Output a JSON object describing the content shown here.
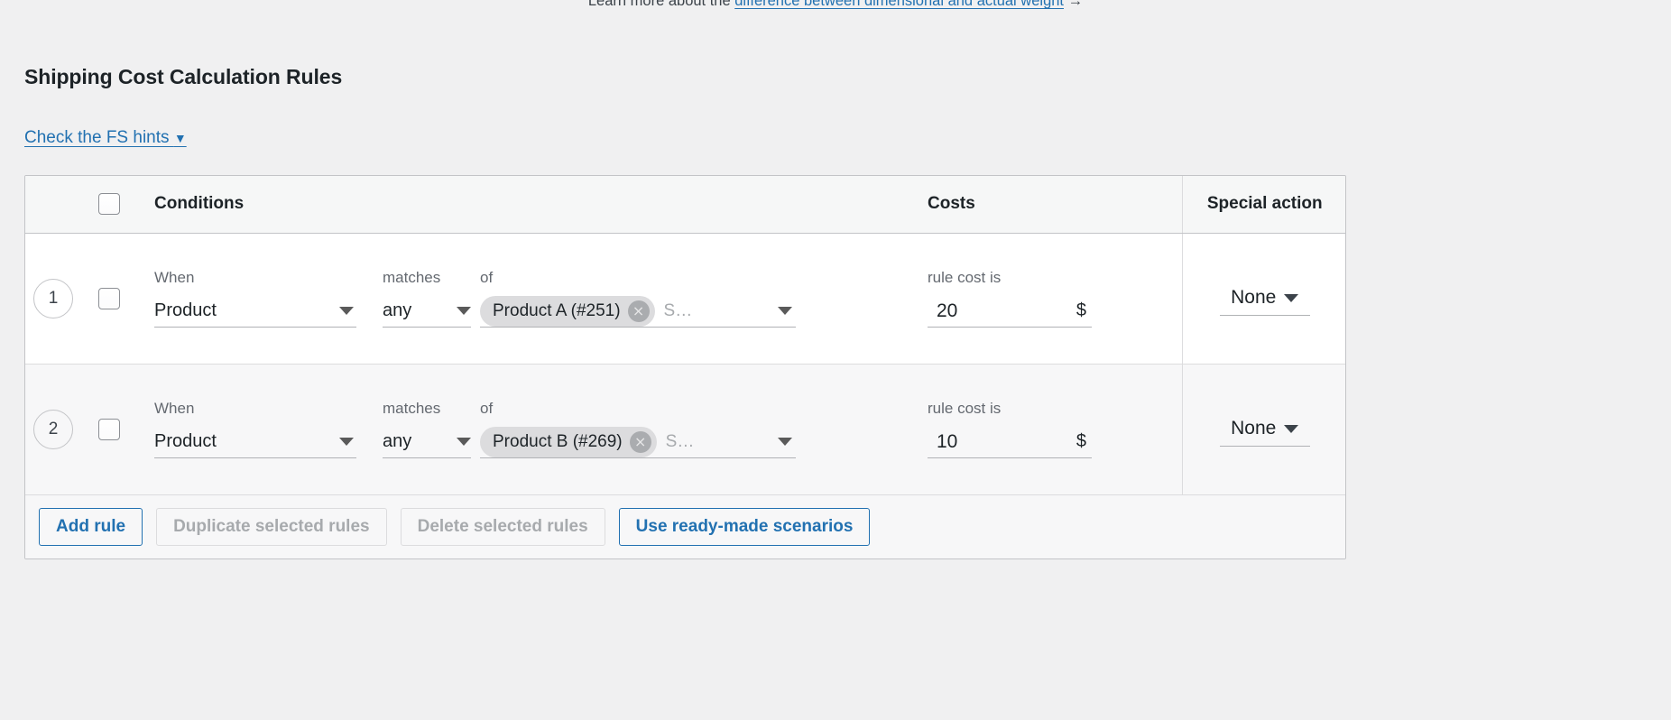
{
  "top_notice": {
    "lead": "Learn more about the ",
    "link": "difference between dimensional and actual weight",
    "arrow": " →"
  },
  "heading": "Shipping Cost Calculation Rules",
  "hints_link": {
    "label": "Check the FS hints",
    "caret": "▼"
  },
  "table": {
    "headers": {
      "conditions": "Conditions",
      "costs": "Costs",
      "special_action": "Special action"
    },
    "select_all_checkbox": "unchecked",
    "rows": [
      {
        "number": "1",
        "checkbox": "unchecked",
        "when_label": "When",
        "when_value": "Product",
        "matches_label": "matches",
        "matches_value": "any",
        "of_label": "of",
        "of_chip": "Product A (#251)",
        "of_chip_remove": "×",
        "of_placeholder": "S…",
        "cost_label": "rule cost is",
        "cost_value": "20",
        "cost_currency": "$",
        "special_action": "None"
      },
      {
        "number": "2",
        "checkbox": "unchecked",
        "when_label": "When",
        "when_value": "Product",
        "matches_label": "matches",
        "matches_value": "any",
        "of_label": "of",
        "of_chip": "Product B (#269)",
        "of_chip_remove": "×",
        "of_placeholder": "S…",
        "cost_label": "rule cost is",
        "cost_value": "10",
        "cost_currency": "$",
        "special_action": "None"
      }
    ]
  },
  "buttons": {
    "add_rule": "Add rule",
    "duplicate_selected": "Duplicate selected rules",
    "delete_selected": "Delete selected rules",
    "ready_made": "Use ready-made scenarios"
  },
  "colors": {
    "link": "#2271b1",
    "page_bg": "#f0f0f1",
    "row_alt_bg": "#f7f7f8",
    "chip_bg": "#dcdcde"
  }
}
